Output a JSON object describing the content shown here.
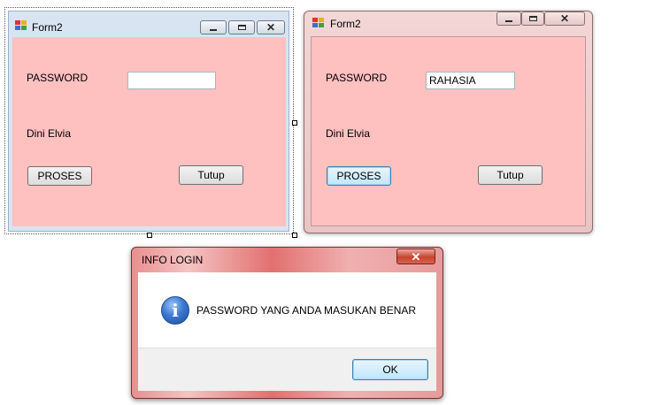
{
  "design_form": {
    "title": "Form2",
    "password_label": "PASSWORD",
    "password_value": "",
    "name_label": "Dini Elvia",
    "proses_label": "PROSES",
    "tutup_label": "Tutup"
  },
  "running_form": {
    "title": "Form2",
    "password_label": "PASSWORD",
    "password_value": "RAHASIA",
    "name_label": "Dini Elvia",
    "proses_label": "PROSES",
    "tutup_label": "Tutup"
  },
  "message_box": {
    "title": "INFO LOGIN",
    "message": "PASSWORD YANG ANDA MASUKAN BENAR",
    "ok_label": "OK",
    "icon": "information-icon"
  },
  "colors": {
    "form_back": "#ffc0c0",
    "designer_frame": "#d8e4f2",
    "focus_blue": "#3c7fb1"
  }
}
